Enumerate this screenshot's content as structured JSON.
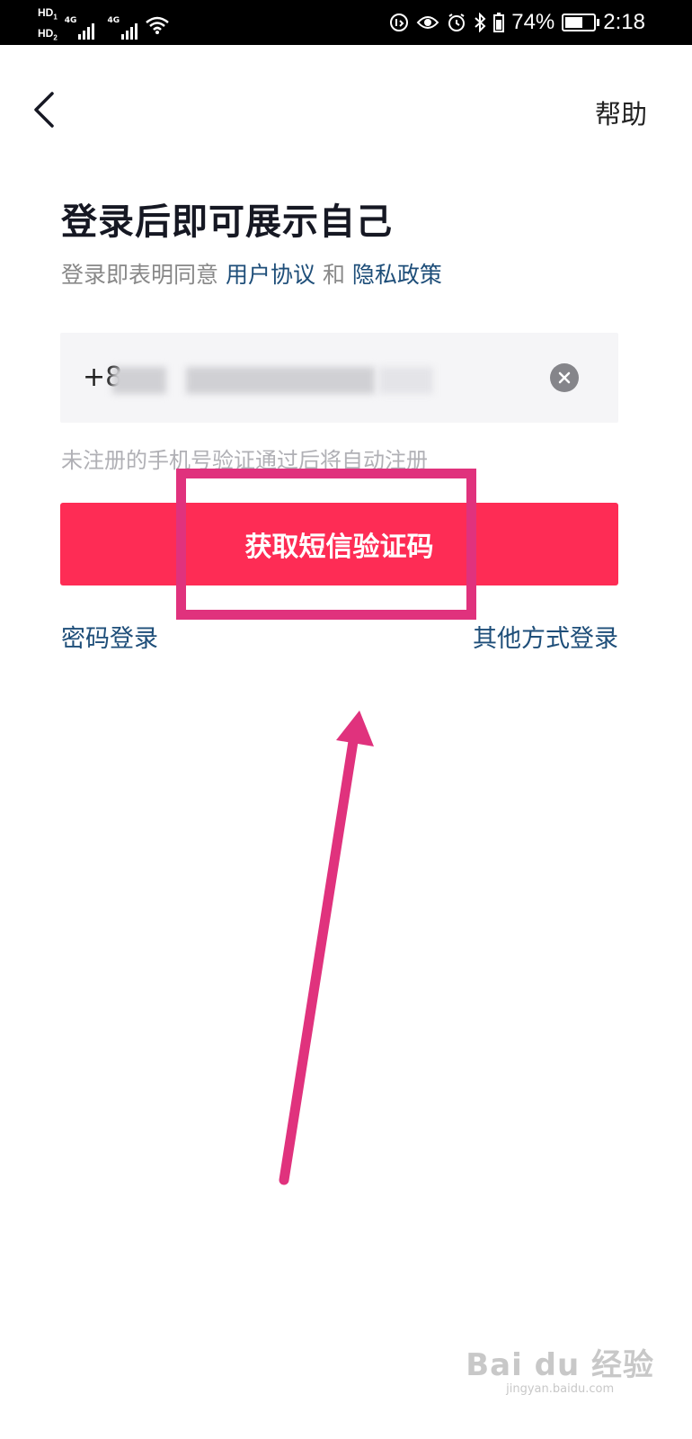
{
  "status_bar": {
    "hd1": "HD",
    "hd2": "HD",
    "net1": "4G",
    "net2": "4G",
    "battery_percent": "74%",
    "battery_level": 0.74,
    "time": "2:18"
  },
  "nav": {
    "back_icon": "chevron-left-icon",
    "help_label": "帮助"
  },
  "title": "登录后即可展示自己",
  "agreement": {
    "prefix": "登录即表明同意",
    "user_agreement": "用户协议",
    "conjunction": "和",
    "privacy_policy": "隐私政策"
  },
  "phone_input": {
    "prefix": "+8",
    "clear_icon": "clear-circle-icon"
  },
  "hint": "未注册的手机号验证通过后将自动注册",
  "sms_button_label": "获取短信验证码",
  "links": {
    "password_login": "密码登录",
    "other_login": "其他方式登录"
  },
  "watermark": {
    "main": "Bai du 经验",
    "sub": "jingyan.baidu.com"
  },
  "colors": {
    "primary_button": "#fe2c55",
    "link": "#1e4e79",
    "annotation": "#e0327d"
  }
}
